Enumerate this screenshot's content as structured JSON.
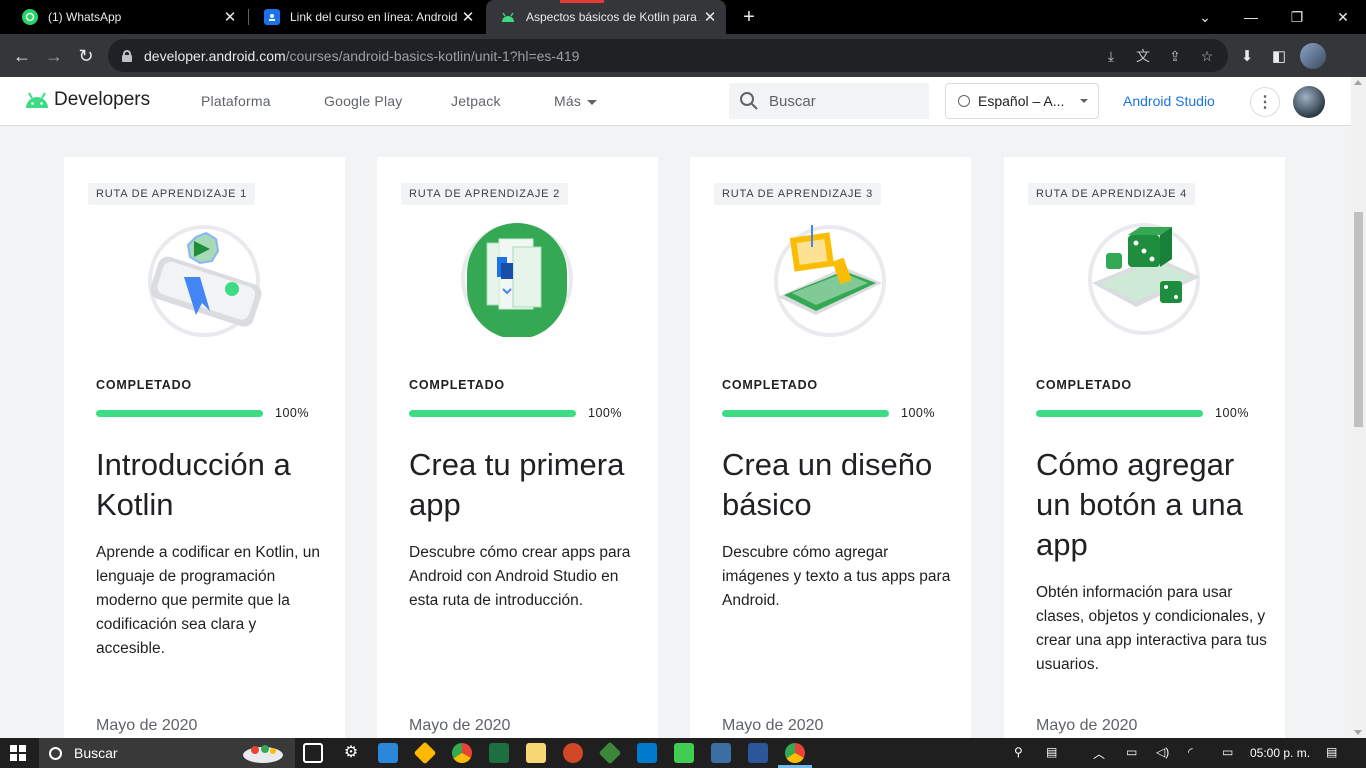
{
  "browser": {
    "tabs": [
      {
        "title": "(1) WhatsApp",
        "favicon": "whatsapp-icon"
      },
      {
        "title": "Link del curso en línea: Android B",
        "favicon": "classroom-icon"
      },
      {
        "title": "Aspectos básicos de Kotlin para A",
        "favicon": "android-icon"
      }
    ],
    "url_host": "developer.android.com",
    "url_path": "/courses/android-basics-kotlin/unit-1?hl=es-419"
  },
  "site_header": {
    "brand": "Developers",
    "nav": [
      "Plataforma",
      "Google Play",
      "Jetpack",
      "Más"
    ],
    "search_placeholder": "Buscar",
    "language": "Español – A...",
    "studio_link": "Android Studio"
  },
  "cards": [
    {
      "chip": "RUTA DE APRENDIZAJE 1",
      "status": "COMPLETADO",
      "progress": 100,
      "progress_label": "100%",
      "title": "Introducción a Kotlin",
      "description": "Aprende a codificar en Kotlin, un lenguaje de programación moderno que permite que la codificación sea clara y accesible.",
      "date": "Mayo de 2020"
    },
    {
      "chip": "RUTA DE APRENDIZAJE 2",
      "status": "COMPLETADO",
      "progress": 100,
      "progress_label": "100%",
      "title": "Crea tu primera app",
      "description": "Descubre cómo crear apps para Android con Android Studio en esta ruta de introducción.",
      "date": "Mayo de 2020"
    },
    {
      "chip": "RUTA DE APRENDIZAJE 3",
      "status": "COMPLETADO",
      "progress": 100,
      "progress_label": "100%",
      "title": "Crea un diseño básico",
      "description": "Descubre cómo agregar imágenes y texto a tus apps para Android.",
      "date": "Mayo de 2020"
    },
    {
      "chip": "RUTA DE APRENDIZAJE 4",
      "status": "COMPLETADO",
      "progress": 100,
      "progress_label": "100%",
      "title": "Cómo agregar un botón a una app",
      "description": "Obtén información para usar clases, objetos y condicionales, y crear una app interactiva para tus usuarios.",
      "date": "Mayo de 2020"
    }
  ],
  "taskbar": {
    "search_placeholder": "Buscar",
    "clock": "05:00 p. m."
  },
  "colors": {
    "progress": "#3ddc84",
    "link": "#1a73e8",
    "android_green": "#3ddc84"
  }
}
